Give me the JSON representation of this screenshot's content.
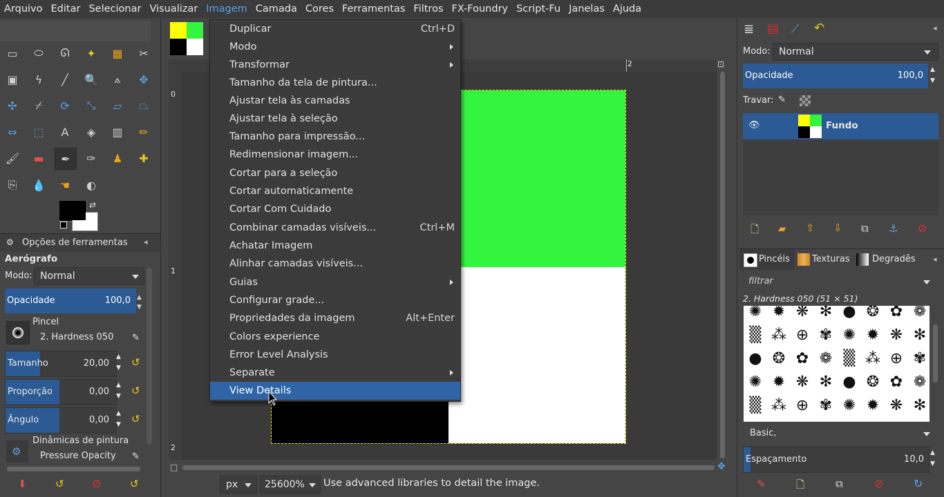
{
  "menubar": [
    "Arquivo",
    "Editar",
    "Selecionar",
    "Visualizar",
    "Imagem",
    "Camada",
    "Cores",
    "Ferramentas",
    "Filtros",
    "FX-Foundry",
    "Script-Fu",
    "Janelas",
    "Ajuda"
  ],
  "image_menu": [
    {
      "label": "Duplicar",
      "accel": "Ctrl+D"
    },
    {
      "label": "Modo",
      "submenu": true
    },
    {
      "label": "Transformar",
      "submenu": true
    },
    {
      "label": "Tamanho da tela de pintura..."
    },
    {
      "label": "Ajustar tela às camadas"
    },
    {
      "label": "Ajustar tela à seleção"
    },
    {
      "label": "Tamanho para impressão..."
    },
    {
      "label": "Redimensionar imagem..."
    },
    {
      "label": "Cortar para a seleção"
    },
    {
      "label": "Cortar automaticamente"
    },
    {
      "label": "Cortar Com Cuidado"
    },
    {
      "label": "Combinar camadas visíveis...",
      "accel": "Ctrl+M"
    },
    {
      "label": "Achatar Imagem"
    },
    {
      "label": "Alinhar camadas visíveis..."
    },
    {
      "label": "Guias",
      "submenu": true
    },
    {
      "label": "Configurar grade..."
    },
    {
      "label": "Propriedades da imagem",
      "accel": "Alt+Enter"
    },
    {
      "label": "Colors experience"
    },
    {
      "label": "Error Level Analysis"
    },
    {
      "label": "Separate",
      "submenu": true
    },
    {
      "label": "View Details",
      "highlighted": true
    }
  ],
  "tool_options": {
    "tab_title": "Opções de ferramentas",
    "tool_name": "Aerógrafo",
    "mode_label": "Modo:",
    "mode_value": "Normal",
    "opacity_label": "Opacidade",
    "opacity_value": "100,0",
    "brush_label": "Pincel",
    "brush_value": "2. Hardness 050",
    "size_label": "Tamanho",
    "size_value": "20,00",
    "ratio_label": "Proporção",
    "ratio_value": "0,00",
    "angle_label": "Ângulo",
    "angle_value": "0,00",
    "dynamics_label": "Dinâmicas de pintura",
    "dynamics_value": "Pressure Opacity"
  },
  "layers": {
    "mode_label": "Modo:",
    "mode_value": "Normal",
    "opacity_label": "Opacidade",
    "opacity_value": "100,0",
    "lock_label": "Travar:",
    "layer_name": "Fundo"
  },
  "brushes": {
    "tabs": [
      "Pincéis",
      "Texturas",
      "Degradês"
    ],
    "filter_placeholder": "filtrar",
    "current": "2. Hardness 050 (51 × 51)",
    "preset": "Basic,",
    "spacing_label": "Espaçamento",
    "spacing_value": "10,0"
  },
  "statusbar": {
    "unit": "px",
    "zoom": "25600%",
    "message": "Use advanced libraries to detail the image."
  },
  "rulers": {
    "h_mark": "2",
    "v_marks": [
      "0",
      "1",
      "2"
    ]
  },
  "colors": {
    "green": "#33f53f",
    "yellow": "#ffff00",
    "black": "#000000",
    "white": "#ffffff",
    "menu_highlight": "#2f65a6",
    "bar_blue": "#2b5a94"
  }
}
